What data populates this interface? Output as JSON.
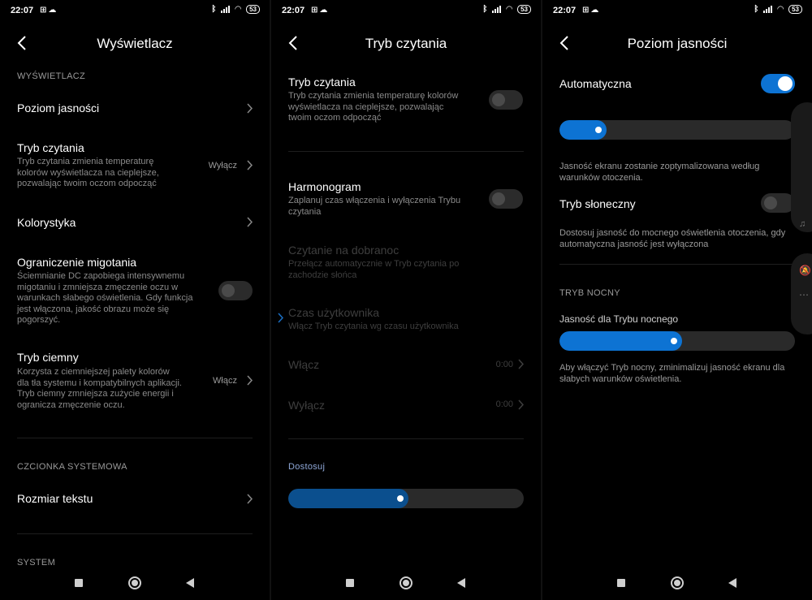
{
  "status": {
    "time": "22:07",
    "battery": "53"
  },
  "panel1": {
    "title": "Wyświetlacz",
    "section_display": "WYŚWIETLACZ",
    "brightness_level": "Poziom jasności",
    "reading_mode": {
      "title": "Tryb czytania",
      "desc": [
        "Tryb czytania zmienia temperaturę",
        "kolorów wyświetlacza na cieplejsze,",
        "pozwalając twoim oczom odpocząć"
      ],
      "value": "Wyłącz"
    },
    "color_scheme": "Kolorystyka",
    "flicker": {
      "title": "Ograniczenie migotania",
      "desc": [
        "Ściemnianie DC zapobiega intensywnemu",
        "migotaniu i zmniejsza zmęczenie oczu w",
        "warunkach słabego oświetlenia. Gdy funkcja",
        "jest włączona, jakość obrazu może się",
        "pogorszyć."
      ]
    },
    "dark_mode": {
      "title": "Tryb ciemny",
      "desc": [
        "Korzysta z ciemniejszej palety kolorów",
        "dla tła systemu i kompatybilnych aplikacji.",
        "Tryb ciemny zmniejsza zużycie energii i",
        "ogranicza zmęczenie oczu."
      ],
      "value": "Włącz"
    },
    "section_font": "CZCIONKA SYSTEMOWA",
    "text_size": "Rozmiar tekstu",
    "section_system": "SYSTEM"
  },
  "panel2": {
    "title": "Tryb czytania",
    "reading_mode": {
      "title": "Tryb czytania",
      "desc": [
        "Tryb czytania zmienia temperaturę kolorów",
        "wyświetlacza na cieplejsze, pozwalając",
        "twoim oczom odpocząć"
      ]
    },
    "schedule": {
      "title": "Harmonogram",
      "desc": [
        "Zaplanuj czas włączenia i wyłączenia Trybu",
        "czytania"
      ]
    },
    "bedtime": {
      "title": "Czytanie na dobranoc",
      "desc": [
        "Przełącz automatycznie w Tryb czytania po",
        "zachodzie słońca"
      ]
    },
    "user_time": {
      "title": "Czas użytkownika",
      "desc": [
        "Włącz Tryb czytania wg czasu użytkownika"
      ]
    },
    "on_label": "Włącz",
    "on_value": "0:00",
    "off_label": "Wyłącz",
    "off_value": "0:00",
    "adjust_label": "Dostosuj",
    "adjust_level": 0.51
  },
  "panel3": {
    "title": "Poziom jasności",
    "auto_label": "Automatyczna",
    "auto_enabled": true,
    "brightness_level": 0.2,
    "auto_desc": [
      "Jasność ekranu zostanie zoptymalizowana według",
      "warunków otoczenia."
    ],
    "sun_mode": "Tryb słoneczny",
    "sun_desc": [
      "Dostosuj jasność do mocnego oświetlenia otoczenia, gdy",
      "automatyczna jasność jest wyłączona"
    ],
    "section_night": "TRYB NOCNY",
    "night_brightness_label": "Jasność dla Trybu nocnego",
    "night_brightness_level": 0.52,
    "night_desc": [
      "Aby włączyć Tryb nocny, zminimalizuj jasność ekranu dla",
      "słabych warunków oświetlenia."
    ]
  },
  "colors": {
    "accent": "#0d73d3",
    "dim_accent": "#0b4f8e",
    "background": "#000000"
  }
}
